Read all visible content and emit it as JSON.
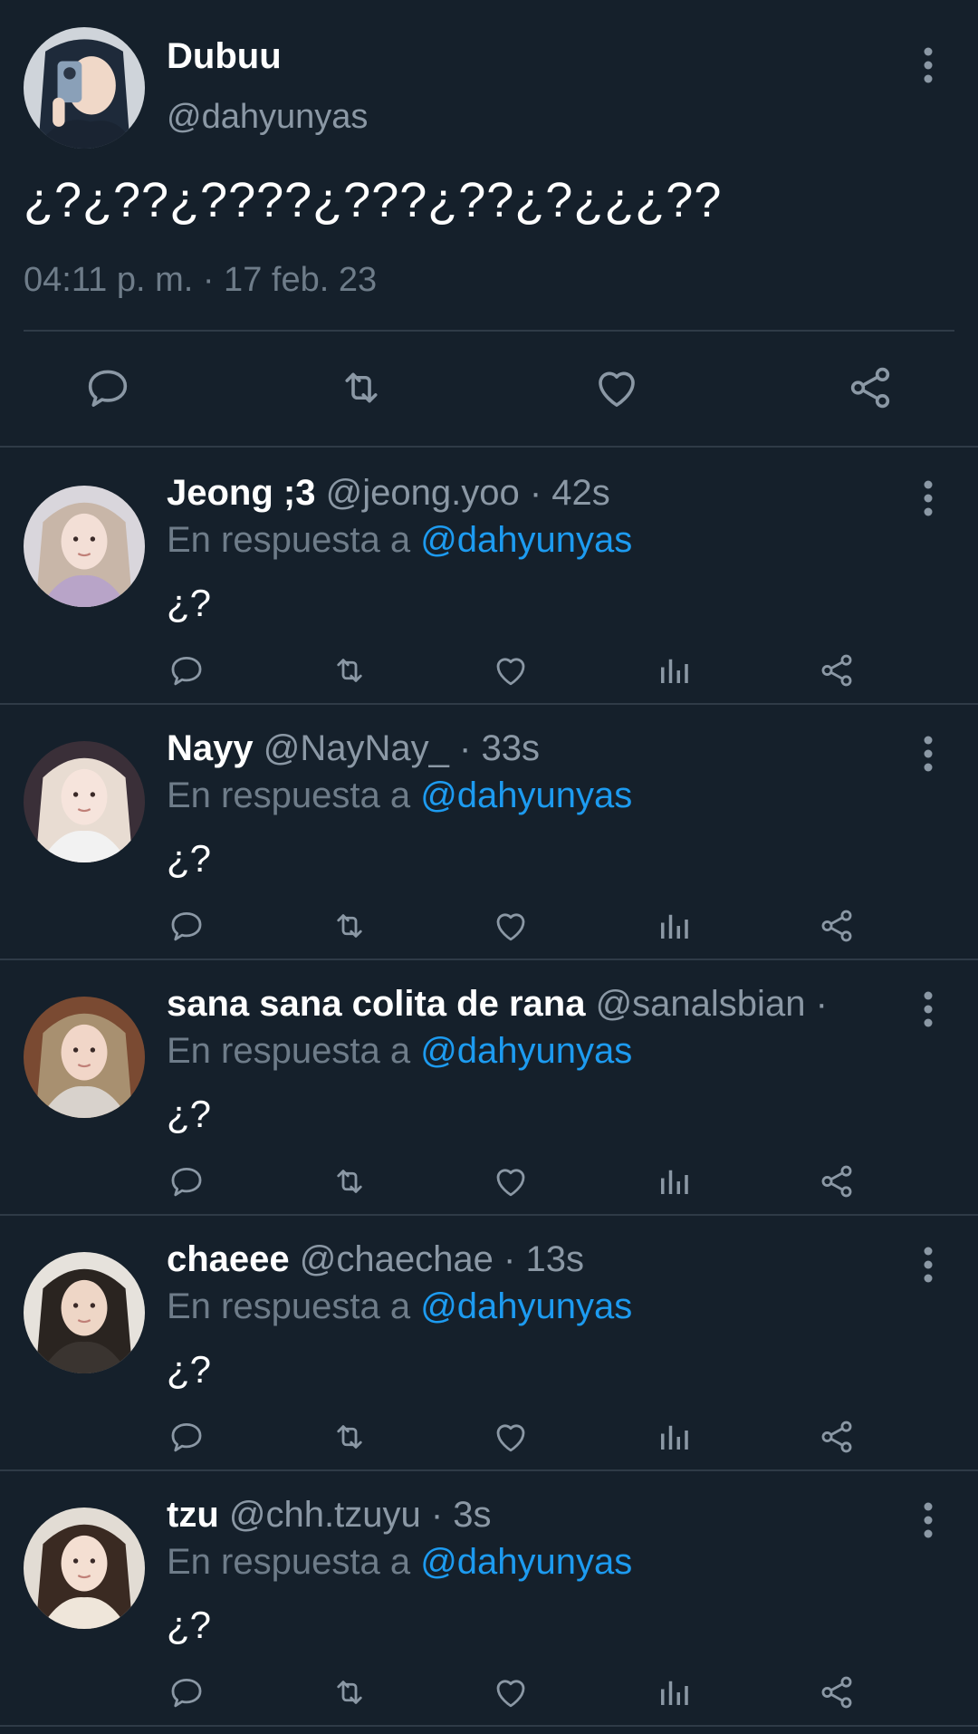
{
  "main_tweet": {
    "display_name": "Dubuu",
    "handle": "@dahyunyas",
    "text": "¿?¿??¿????¿???¿??¿?¿¿¿??",
    "timestamp": "04:11 p. m. · 17 feb. 23",
    "avatar_colors": {
      "bg": "#cfd4da",
      "hair": "#1e2a3a",
      "skin": "#f0d8c8",
      "phone": "#8aa0b8"
    },
    "actions": [
      "reply-icon",
      "retweet-icon",
      "like-icon",
      "share-icon"
    ]
  },
  "reply_prefix": "En respuesta a",
  "replies": [
    {
      "display_name": "Jeong ;3",
      "handle": "@jeong.yoo",
      "separator": "·",
      "time": "42s",
      "reply_to": "@dahyunyas",
      "text": "¿?",
      "avatar_colors": {
        "bg": "#d9d6dc",
        "hair": "#c8b6a8",
        "skin": "#f3dfd6",
        "cloth": "#b8a4c8"
      }
    },
    {
      "display_name": "Nayy",
      "handle": "@NayNay_",
      "separator": "·",
      "time": "33s",
      "reply_to": "@dahyunyas",
      "text": "¿?",
      "avatar_colors": {
        "bg": "#3a2f38",
        "hair": "#e8dcd2",
        "skin": "#f6e4dc",
        "cloth": "#f2f2f2"
      }
    },
    {
      "display_name": "sana sana colita de rana",
      "handle": "@sanalsbian",
      "separator": "·",
      "time": "",
      "reply_to": "@dahyunyas",
      "text": "¿?",
      "avatar_colors": {
        "bg": "#7a4a32",
        "hair": "#a89070",
        "skin": "#f1d6c8",
        "cloth": "#d8d2cc"
      }
    },
    {
      "display_name": "chaeee",
      "handle": "@chaechae",
      "separator": "·",
      "time": "13s",
      "reply_to": "@dahyunyas",
      "text": "¿?",
      "avatar_colors": {
        "bg": "#e6e2dc",
        "hair": "#2a2420",
        "skin": "#eed6c6",
        "cloth": "#3a3430"
      }
    },
    {
      "display_name": "tzu",
      "handle": "@chh.tzuyu",
      "separator": "·",
      "time": "3s",
      "reply_to": "@dahyunyas",
      "text": "¿?",
      "avatar_colors": {
        "bg": "#e2dcd4",
        "hair": "#3a2a22",
        "skin": "#f4dfd2",
        "cloth": "#efe6da"
      }
    }
  ],
  "reply_actions": [
    "reply-icon",
    "retweet-icon",
    "like-icon",
    "views-icon",
    "share-icon"
  ],
  "colors": {
    "background": "#15202b",
    "icon": "#8b98a5",
    "secondary_text": "#8b98a5",
    "mention": "#1d9bf0",
    "divider": "#2f3b47"
  }
}
